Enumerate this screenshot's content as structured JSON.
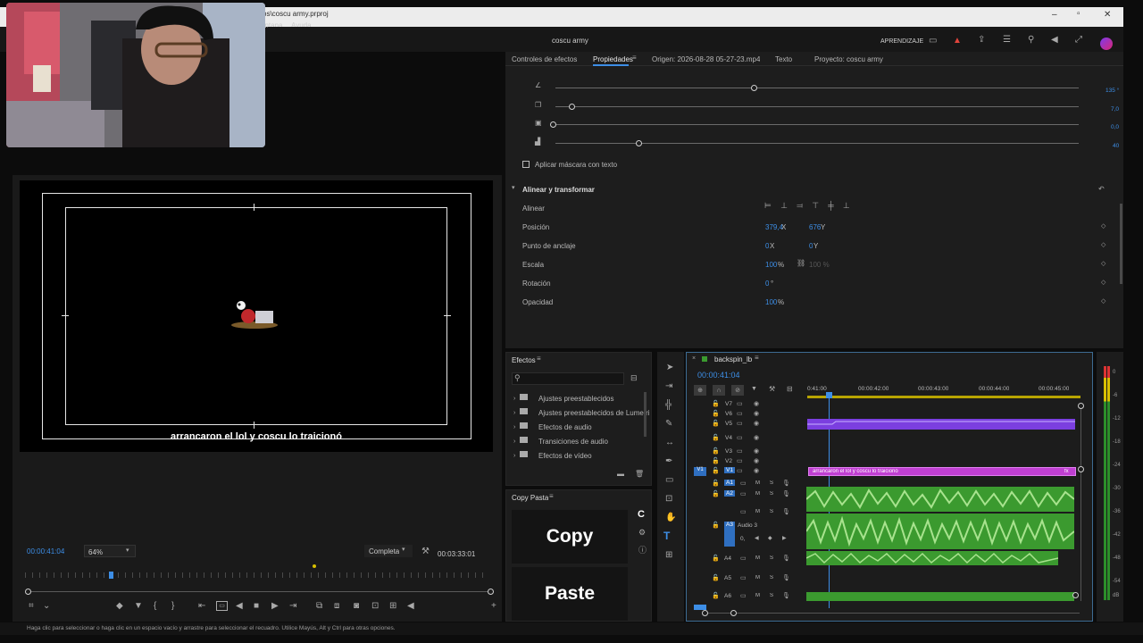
{
  "window": {
    "title": "vos\\coscu army.prproj",
    "app_title": "coscu army",
    "minimize": "–",
    "maximize": "▫",
    "close": "✕"
  },
  "menu": {
    "items": [
      "entana",
      "Ayuda"
    ]
  },
  "appbar": {
    "learning": "APRENDIZAJE"
  },
  "props_panel": {
    "tabs": [
      "Controles de efectos",
      "Propiedades",
      "Origen: 2026-08-28 05-27-23.mp4",
      "Texto",
      "Proyecto: coscu army"
    ],
    "slider_values": [
      "135 °",
      "7,0",
      "0,0",
      "40"
    ],
    "slider_levels": [
      0.39,
      0.03,
      0.0,
      0.16
    ],
    "mask_text": "Aplicar máscara con texto",
    "section": "Alinear y transformar",
    "rows": [
      {
        "label": "Alinear"
      },
      {
        "label": "Posición",
        "v1": "379,4",
        "u1": "X",
        "v2": "676",
        "u2": "Y"
      },
      {
        "label": "Punto de anclaje",
        "v1": "0",
        "u1": "X",
        "v2": "0",
        "u2": "Y"
      },
      {
        "label": "Escala",
        "v1": "100",
        "u1": "%",
        "v2": "100 %",
        "u2": ""
      },
      {
        "label": "Rotación",
        "v1": "0",
        "u1": "°",
        "v2": "",
        "u2": ""
      },
      {
        "label": "Opacidad",
        "v1": "100",
        "u1": "%",
        "v2": "",
        "u2": ""
      }
    ]
  },
  "program": {
    "caption": "arrancaron el lol y coscu lo traicionó",
    "timecode": "00:00:41:04",
    "zoom": "64%",
    "quality": "Completa",
    "duration": "00:03:33:01"
  },
  "effects": {
    "title": "Efectos",
    "items": [
      "Ajustes preestablecidos",
      "Ajustes preestablecidos de Lumetri",
      "Efectos de audio",
      "Transiciones de audio",
      "Efectos de vídeo"
    ]
  },
  "copypaste": {
    "title": "Copy Pasta",
    "copy": "Copy",
    "paste": "Paste",
    "c_icon": "C"
  },
  "timeline": {
    "sequence": "backspin_lb",
    "timecode": "00:00:41:04",
    "ruler": [
      "0:41:00",
      "00:00:42:00",
      "00:00:43:00",
      "00:00:44:00",
      "00:00:45:00"
    ],
    "video_tracks": [
      "V7",
      "V6",
      "V5",
      "V4",
      "V3",
      "V2",
      "V1"
    ],
    "audio_tracks": [
      "A1",
      "A2",
      "A3",
      "A4",
      "A5",
      "A6"
    ],
    "audio3_name": "Audio 3",
    "audio3_level": "0,",
    "source_v1": "V1",
    "text_clip": "arrancaron el lol y coscu lo traicionó",
    "m_label": "M",
    "s_label": "S",
    "fx_label": "fx"
  },
  "meter": {
    "scale": [
      "0",
      "-6",
      "-12",
      "-18",
      "-24",
      "-30",
      "-36",
      "-42",
      "-48",
      "-54",
      "dB"
    ]
  },
  "status": {
    "text": "Haga clic para seleccionar o haga clic en un espacio vacío y arrastre para seleccionar el recuadro. Utilice Mayús, Alt y Ctrl para otras opciones."
  },
  "colors": {
    "accent": "#3d8ee6",
    "video_clip": "#7b3fe0",
    "text_clip": "#c03fd2",
    "audio_clip": "#3b9a2f"
  }
}
